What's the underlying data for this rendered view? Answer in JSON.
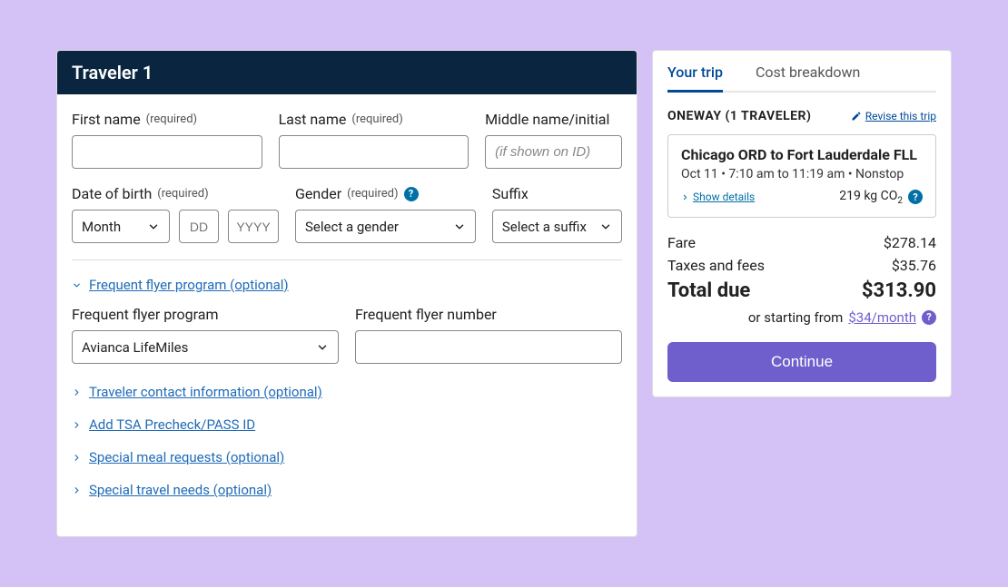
{
  "form": {
    "header": "Traveler 1",
    "firstName": {
      "label": "First name",
      "req": "(required)"
    },
    "lastName": {
      "label": "Last name",
      "req": "(required)"
    },
    "middleName": {
      "label": "Middle name/initial",
      "placeholder": "(if shown on ID)"
    },
    "dob": {
      "label": "Date of birth",
      "req": "(required)",
      "month": "Month",
      "dd": "DD",
      "yyyy": "YYYY"
    },
    "gender": {
      "label": "Gender",
      "req": "(required)",
      "placeholder": "Select a gender"
    },
    "suffix": {
      "label": "Suffix",
      "placeholder": "Select a suffix"
    },
    "ffAccordion": "Frequent flyer program (optional)",
    "ffProgram": {
      "label": "Frequent flyer program",
      "value": "Avianca LifeMiles"
    },
    "ffNumber": {
      "label": "Frequent flyer number"
    },
    "accordions": {
      "contact": "Traveler contact information (optional)",
      "tsa": "Add TSA Precheck/PASS ID",
      "meal": "Special meal requests (optional)",
      "needs": "Special travel needs (optional)"
    }
  },
  "trip": {
    "tabs": {
      "yourTrip": "Your trip",
      "costBreakdown": "Cost breakdown"
    },
    "type": "ONEWAY (1 TRAVELER)",
    "revise": "Revise this trip",
    "route": "Chicago ORD to Fort Lauderdale FLL",
    "details": "Oct 11 • 7:10 am to 11:19 am • Nonstop",
    "showDetails": "Show details",
    "co2": "219 kg CO",
    "fare": {
      "label": "Fare",
      "value": "$278.14"
    },
    "taxes": {
      "label": "Taxes and fees",
      "value": "$35.76"
    },
    "total": {
      "label": "Total due",
      "value": "$313.90"
    },
    "monthly": {
      "prefix": "or starting from",
      "value": "$34/month"
    },
    "continue": "Continue"
  }
}
